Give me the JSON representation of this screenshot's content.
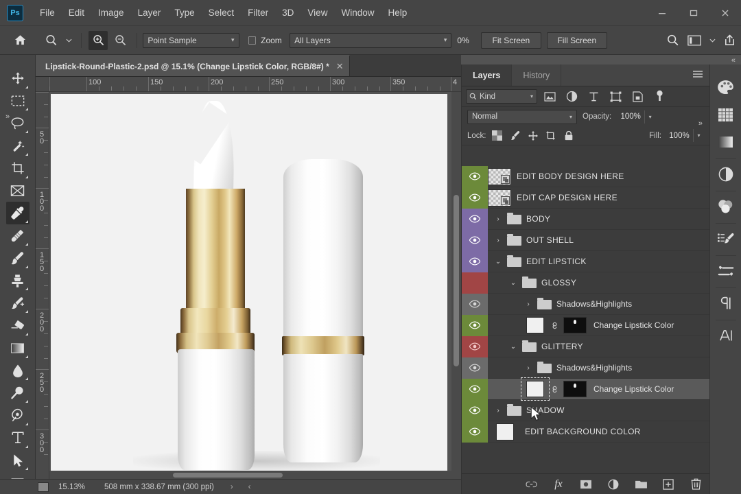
{
  "app": {
    "name": "Adobe Photoshop",
    "logo_text": "Ps"
  },
  "menubar": {
    "items": [
      {
        "label": "File"
      },
      {
        "label": "Edit"
      },
      {
        "label": "Image"
      },
      {
        "label": "Layer"
      },
      {
        "label": "Type"
      },
      {
        "label": "Select"
      },
      {
        "label": "Filter"
      },
      {
        "label": "3D"
      },
      {
        "label": "View"
      },
      {
        "label": "Window"
      },
      {
        "label": "Help"
      }
    ],
    "window_controls": {
      "minimize": "—",
      "maximize": "▭",
      "close": "✕"
    }
  },
  "options_bar": {
    "home_icon": "home-icon",
    "tool_preset_icon": "eyedropper-preset-icon",
    "zoom_in_icon": "zoom-in-icon",
    "zoom_out_icon": "zoom-out-icon",
    "sample_size": "Point Sample",
    "zoom_checkbox_label": "Zoom",
    "zoom_checked": false,
    "sample_scope": "All Layers",
    "percent_value": "0%",
    "fit_screen_label": "Fit Screen",
    "fill_screen_label": "Fill Screen",
    "search_icon": "search-icon",
    "workspace_icon": "workspace-icon",
    "share_icon": "share-icon"
  },
  "toolbar": {
    "tools": [
      {
        "name": "move-tool",
        "icon": "move-icon",
        "active": false,
        "has_flyout": true
      },
      {
        "name": "marquee-tool",
        "icon": "rectangular-marquee-icon",
        "active": false,
        "has_flyout": true
      },
      {
        "name": "lasso-tool",
        "icon": "lasso-icon",
        "active": false,
        "has_flyout": true
      },
      {
        "name": "magic-wand-tool",
        "icon": "magic-wand-icon",
        "active": false,
        "has_flyout": true
      },
      {
        "name": "crop-tool",
        "icon": "crop-icon",
        "active": false,
        "has_flyout": true
      },
      {
        "name": "frame-tool",
        "icon": "frame-icon",
        "active": false,
        "has_flyout": false
      },
      {
        "name": "eyedropper-tool",
        "icon": "eyedropper-icon",
        "active": true,
        "has_flyout": true
      },
      {
        "name": "healing-brush-tool",
        "icon": "healing-brush-icon",
        "active": false,
        "has_flyout": true
      },
      {
        "name": "brush-tool",
        "icon": "brush-icon",
        "active": false,
        "has_flyout": true
      },
      {
        "name": "clone-stamp-tool",
        "icon": "clone-stamp-icon",
        "active": false,
        "has_flyout": true
      },
      {
        "name": "history-brush-tool",
        "icon": "history-brush-icon",
        "active": false,
        "has_flyout": true
      },
      {
        "name": "eraser-tool",
        "icon": "eraser-icon",
        "active": false,
        "has_flyout": true
      },
      {
        "name": "gradient-tool",
        "icon": "gradient-icon",
        "active": false,
        "has_flyout": true
      },
      {
        "name": "blur-tool",
        "icon": "blur-droplet-icon",
        "active": false,
        "has_flyout": true
      },
      {
        "name": "dodge-tool",
        "icon": "dodge-icon",
        "active": false,
        "has_flyout": true
      },
      {
        "name": "pen-tool",
        "icon": "pen-icon",
        "active": false,
        "has_flyout": true
      },
      {
        "name": "type-tool",
        "icon": "type-icon",
        "active": false,
        "has_flyout": true
      },
      {
        "name": "path-selection-tool",
        "icon": "path-selection-icon",
        "active": false,
        "has_flyout": true
      },
      {
        "name": "rectangle-tool",
        "icon": "rectangle-shape-icon",
        "active": false,
        "has_flyout": true
      }
    ]
  },
  "document": {
    "tab_title": "Lipstick-Round-Plastic-2.psd @ 15.1% (Change Lipstick Color, RGB/8#) *",
    "close_glyph": "✕",
    "ruler_h_labels": [
      "100",
      "150",
      "200",
      "250",
      "300",
      "350",
      "4"
    ],
    "ruler_v_labels": [
      "50",
      "100",
      "150",
      "200",
      "250",
      "300"
    ],
    "canvas_description": "White and gold lipstick mockup, open bullet on left and capped tube on right"
  },
  "status_bar": {
    "zoom": "15.13%",
    "dimensions": "508 mm x 338.67 mm (300 ppi)",
    "arrow_right": "›",
    "arrow_left": "‹"
  },
  "layers_panel": {
    "tabs": [
      {
        "label": "Layers",
        "active": true
      },
      {
        "label": "History",
        "active": false
      }
    ],
    "menu_icon": "panel-menu-icon",
    "filter": {
      "kind_label": "Kind",
      "search_icon": "search-icon",
      "caret": "∨",
      "icons": [
        {
          "name": "filter-pixel-icon",
          "glyph": "image"
        },
        {
          "name": "filter-adjustment-icon",
          "glyph": "adjustment"
        },
        {
          "name": "filter-type-icon",
          "glyph": "T"
        },
        {
          "name": "filter-shape-icon",
          "glyph": "shape"
        },
        {
          "name": "filter-smart-object-icon",
          "glyph": "smart"
        },
        {
          "name": "filter-toggle-icon",
          "glyph": "toggle"
        }
      ]
    },
    "blend_mode": "Normal",
    "opacity_label": "Opacity:",
    "opacity_value": "100%",
    "lock_label": "Lock:",
    "fill_label": "Fill:",
    "fill_value": "100%",
    "lock_icons": [
      {
        "name": "lock-transparent-pixels-icon"
      },
      {
        "name": "lock-image-pixels-icon"
      },
      {
        "name": "lock-position-icon"
      },
      {
        "name": "lock-artboard-nesting-icon"
      },
      {
        "name": "lock-all-icon"
      }
    ],
    "layers": [
      {
        "name": "EDIT BODY DESIGN HERE",
        "type": "smart-object",
        "visible": true,
        "eye_color": "#6c8a3a",
        "indent": 0,
        "selected": false,
        "has_disclosure": false
      },
      {
        "name": "EDIT CAP DESIGN HERE",
        "type": "smart-object",
        "visible": true,
        "eye_color": "#6c8a3a",
        "indent": 0,
        "selected": false,
        "has_disclosure": false
      },
      {
        "name": "BODY",
        "type": "group",
        "visible": true,
        "eye_color": "#7d6ba6",
        "indent": 0,
        "selected": false,
        "has_disclosure": true,
        "expanded": false
      },
      {
        "name": "OUT SHELL",
        "type": "group",
        "visible": true,
        "eye_color": "#7d6ba6",
        "indent": 0,
        "selected": false,
        "has_disclosure": true,
        "expanded": false
      },
      {
        "name": "EDIT LIPSTICK",
        "type": "group",
        "visible": true,
        "eye_color": "#7d6ba6",
        "indent": 0,
        "selected": false,
        "has_disclosure": true,
        "expanded": true
      },
      {
        "name": "GLOSSY",
        "type": "group",
        "visible": false,
        "eye_color": "#a14545",
        "indent": 1,
        "selected": false,
        "has_disclosure": true,
        "expanded": true
      },
      {
        "name": "Shadows&Highlights",
        "type": "group",
        "visible": true,
        "eye_color": "#6b6b6b",
        "indent": 2,
        "selected": false,
        "has_disclosure": true,
        "expanded": false
      },
      {
        "name": "Change Lipstick Color",
        "type": "fill-with-mask",
        "visible": true,
        "eye_color": "#6c8a3a",
        "indent": 2,
        "selected": false,
        "has_disclosure": false
      },
      {
        "name": "GLITTERY",
        "type": "group",
        "visible": true,
        "eye_color": "#a14545",
        "indent": 1,
        "selected": false,
        "has_disclosure": true,
        "expanded": true
      },
      {
        "name": "Shadows&Highlights",
        "type": "group",
        "visible": true,
        "eye_color": "#6b6b6b",
        "indent": 2,
        "selected": false,
        "has_disclosure": true,
        "expanded": false
      },
      {
        "name": "Change Lipstick Color",
        "type": "fill-with-mask",
        "visible": true,
        "eye_color": "#6c8a3a",
        "indent": 2,
        "selected": true,
        "has_disclosure": false,
        "thumbnail_focused": true
      },
      {
        "name": "SHADOW",
        "type": "group",
        "visible": true,
        "eye_color": "#6c8a3a",
        "indent": 0,
        "selected": false,
        "has_disclosure": true,
        "expanded": false
      },
      {
        "name": "EDIT BACKGROUND COLOR",
        "type": "solid-fill",
        "visible": true,
        "eye_color": "#6c8a3a",
        "indent": 0,
        "selected": false,
        "has_disclosure": false
      }
    ],
    "footer_buttons": [
      {
        "name": "link-layers-button",
        "icon": "link-icon"
      },
      {
        "name": "layer-style-button",
        "icon": "fx-icon",
        "label": "fx"
      },
      {
        "name": "add-layer-mask-button",
        "icon": "mask-icon"
      },
      {
        "name": "new-adjustment-layer-button",
        "icon": "adjustment-icon"
      },
      {
        "name": "new-group-button",
        "icon": "folder-icon"
      },
      {
        "name": "new-layer-button",
        "icon": "new-layer-icon"
      },
      {
        "name": "delete-layer-button",
        "icon": "trash-icon"
      }
    ]
  },
  "right_dock": {
    "items": [
      {
        "name": "color-panel-icon",
        "label": "Color"
      },
      {
        "name": "swatches-panel-icon",
        "label": "Swatches"
      },
      {
        "name": "gradients-panel-icon",
        "label": "Gradients"
      },
      {
        "name": "adjustments-panel-icon",
        "label": "Adjustments"
      },
      {
        "name": "libraries-panel-icon",
        "label": "Libraries"
      },
      {
        "name": "brushes-panel-icon",
        "label": "Brushes"
      },
      {
        "name": "brush-settings-panel-icon",
        "label": "Brush Settings"
      },
      {
        "name": "paragraph-panel-icon",
        "label": "Paragraph"
      },
      {
        "name": "character-panel-icon",
        "label": "Character"
      }
    ]
  },
  "colors": {
    "chrome": "#454545",
    "panel": "#3c3c3c",
    "canvas_bg": "#535353",
    "accent_blue": "#41b6e6",
    "eye_green": "#6c8a3a",
    "eye_violet": "#7d6ba6",
    "eye_red": "#a14545",
    "selection": "#5a5a5a"
  }
}
